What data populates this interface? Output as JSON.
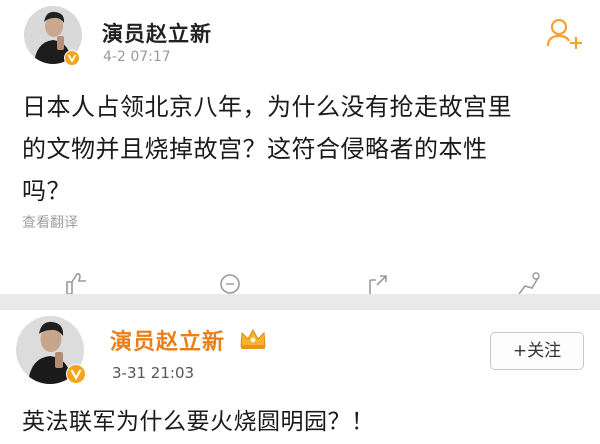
{
  "post1": {
    "author": "演员赵立新",
    "timestamp": "4-2 07:17",
    "text_lines": [
      "日本人占领北京八年，为什么没有抢走故宫里",
      "的文物并且烧掉故宫？这符合侵略者的本性",
      "吗？"
    ],
    "translate_label": "查看翻译",
    "actions": [
      "like-icon",
      "comment-icon",
      "share-icon",
      "favorite-icon"
    ]
  },
  "post2": {
    "author": "演员赵立新",
    "timestamp": "3-31 21:03",
    "follow_label": "+关注",
    "text": "英法联军为什么要火烧圆明园？！"
  },
  "colors": {
    "verified_badge": "#f2a51a",
    "author_name_highlight": "#ea7f19",
    "follow_icon": "#f0a330",
    "muted_text": "#9a9a9a",
    "separator": "#e9e9e9"
  }
}
